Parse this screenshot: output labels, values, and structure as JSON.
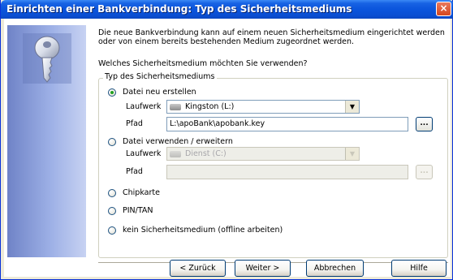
{
  "window": {
    "title": "Einrichten einer Bankverbindung: Typ des Sicherheitsmediums",
    "close_label": "×"
  },
  "intro": {
    "text": "Die neue Bankverbindung kann  auf einem neuen Sicherheitsmedium eingerichtet werden oder von einem bereits bestehenden Medium zugeordnet werden.",
    "question": "Welches Sicherheitsmedium möchten Sie verwenden?"
  },
  "group": {
    "legend": "Typ des Sicherheitsmediums",
    "options": {
      "neu": {
        "label": "Datei neu erstellen",
        "checked": true
      },
      "verwenden": {
        "label": "Datei verwenden / erweitern",
        "checked": false
      },
      "chipkarte": {
        "label": "Chipkarte",
        "checked": false
      },
      "pintan": {
        "label": "PIN/TAN",
        "checked": false
      },
      "offline": {
        "label": "kein Sicherheitsmedium (offline arbeiten)",
        "checked": false
      }
    },
    "neu_fields": {
      "laufwerk_label": "Laufwerk",
      "laufwerk_value": "Kingston (L:)",
      "pfad_label": "Pfad",
      "pfad_value": "L:\\apoBank\\apobank.key",
      "browse_label": "..."
    },
    "verwenden_fields": {
      "laufwerk_label": "Laufwerk",
      "laufwerk_value": "Dienst (C:)",
      "pfad_label": "Pfad",
      "pfad_value": "",
      "browse_label": "..."
    }
  },
  "buttons": {
    "back": "< Zurück",
    "next": "Weiter >",
    "cancel": "Abbrechen",
    "help": "Hilfe"
  },
  "colors": {
    "titlebar": "#0b55dc",
    "dialog_background": "#ece9d8",
    "radio_checked": "#21a121"
  },
  "icons": {
    "side_image": "key-icon",
    "drive": "drive-icon",
    "dropdown": "chevron-down-icon"
  }
}
